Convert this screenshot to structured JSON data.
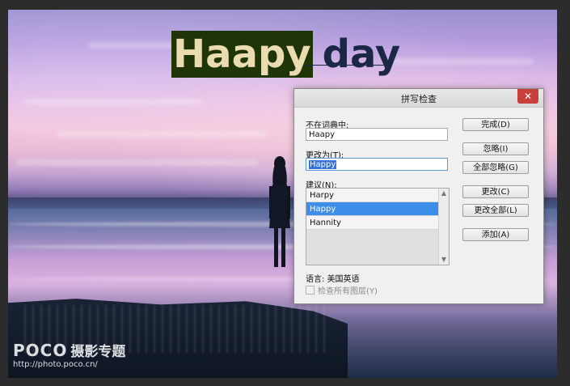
{
  "canvas": {
    "text_layer": {
      "highlighted_word": "Haapy",
      "rest_text": "day"
    },
    "watermark": {
      "brand": "POCO",
      "brand_cn": "摄影专题",
      "url": "http://photo.poco.cn/"
    }
  },
  "dialog": {
    "title": "拼写检查",
    "close_glyph": "✕",
    "not_in_dictionary_label": "不在词典中:",
    "not_in_dictionary_value": "Haapy",
    "change_to_label": "更改为(T):",
    "change_to_value": "Happy",
    "suggestions_label": "建议(N):",
    "suggestions": [
      "Harpy",
      "Happy",
      "Hannity"
    ],
    "selected_suggestion": "Happy",
    "buttons": {
      "done": "完成(D)",
      "ignore": "忽略(I)",
      "ignore_all": "全部忽略(G)",
      "change": "更改(C)",
      "change_all": "更改全部(L)",
      "add": "添加(A)"
    },
    "language_label": "语言: 美国英语",
    "check_all_layers": "检查所有图层(Y)",
    "check_all_layers_checked": false
  },
  "colors": {
    "highlight_bg": "#1f3508",
    "highlight_text": "#eadbb0",
    "title_text": "#1c2746",
    "selection_blue": "#3d8ee8",
    "close_red": "#c9403a"
  }
}
